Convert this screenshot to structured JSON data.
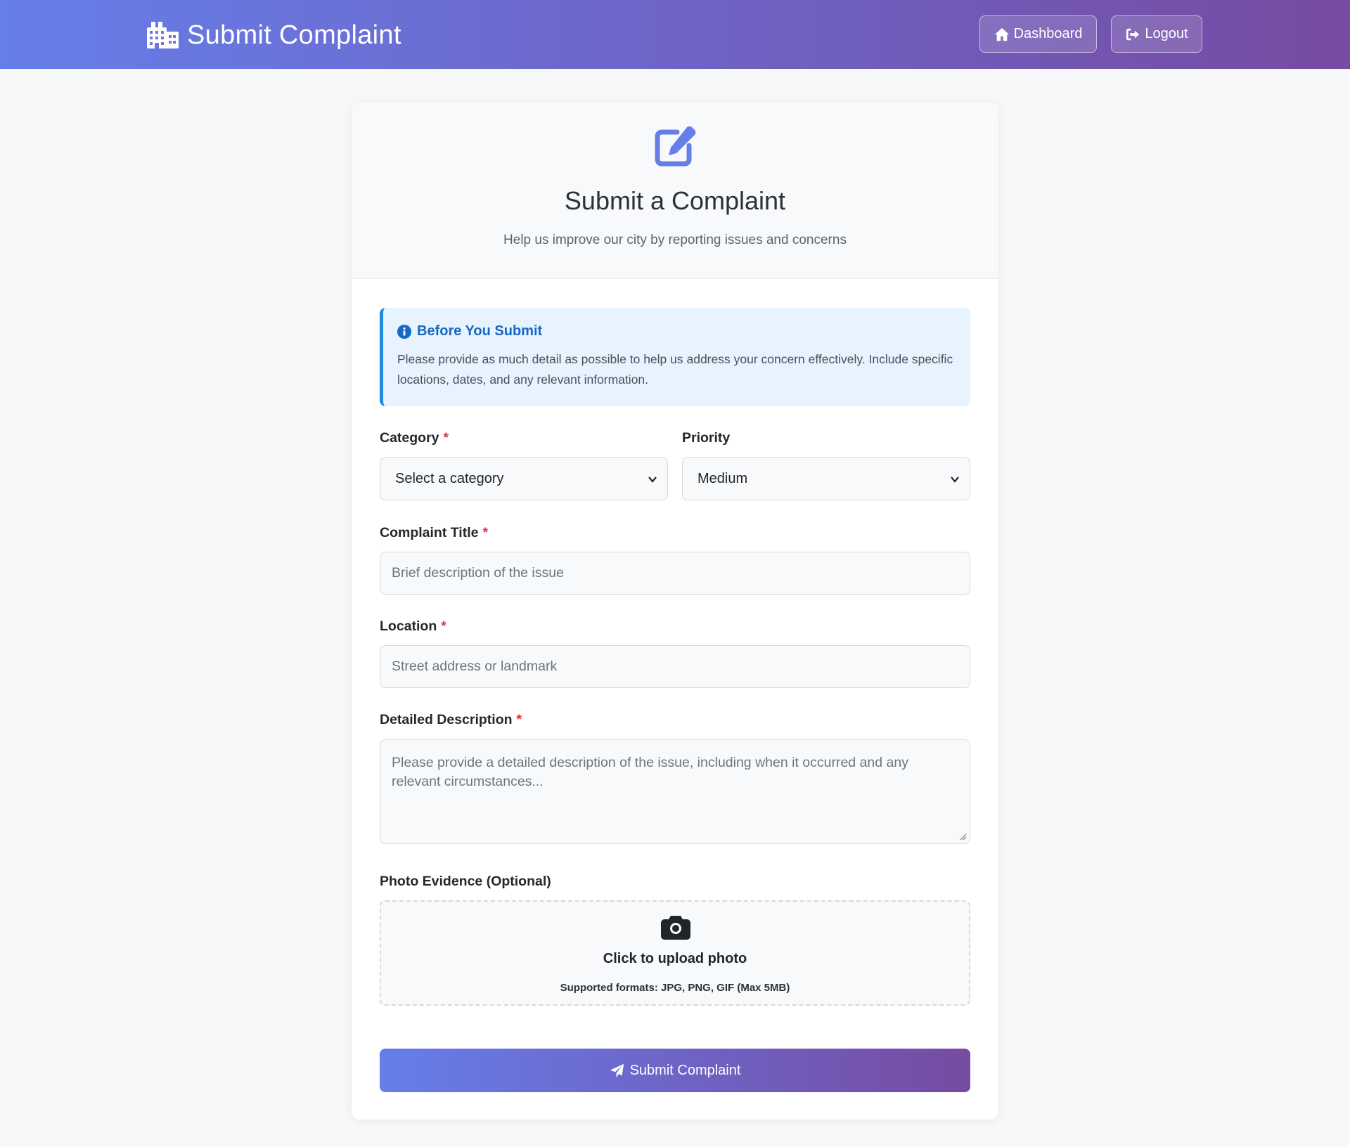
{
  "header": {
    "title": "Submit Complaint",
    "brand_icon": "city-icon",
    "buttons": [
      {
        "label": "Dashboard",
        "icon": "home-icon"
      },
      {
        "label": "Logout",
        "icon": "logout-icon"
      }
    ]
  },
  "card": {
    "icon": "edit-icon",
    "title": "Submit a Complaint",
    "subtitle": "Help us improve our city by reporting issues and concerns"
  },
  "info": {
    "icon": "info-icon",
    "title": "Before You Submit",
    "text": "Please provide as much detail as possible to help us address your concern effectively. Include specific locations, dates, and any relevant information."
  },
  "form": {
    "category": {
      "label": "Category",
      "required": "*",
      "value": "Select a category"
    },
    "priority": {
      "label": "Priority",
      "value": "Medium"
    },
    "title": {
      "label": "Complaint Title",
      "required": "*",
      "placeholder": "Brief description of the issue"
    },
    "location": {
      "label": "Location",
      "required": "*",
      "placeholder": "Street address or landmark"
    },
    "description": {
      "label": "Detailed Description",
      "required": "*",
      "placeholder": "Please provide a detailed description of the issue, including when it occurred and any relevant circumstances..."
    },
    "photo": {
      "label": "Photo Evidence (Optional)",
      "icon": "camera-icon",
      "cta": "Click to upload photo",
      "formats": "Supported formats: JPG, PNG, GIF (Max 5MB)"
    },
    "submit": {
      "label": "Submit Complaint",
      "icon": "paper-plane-icon"
    }
  },
  "colors": {
    "gradient_start": "#667eea",
    "gradient_end": "#764ba2",
    "info_accent": "#1f8be0",
    "required": "#dc3545"
  }
}
